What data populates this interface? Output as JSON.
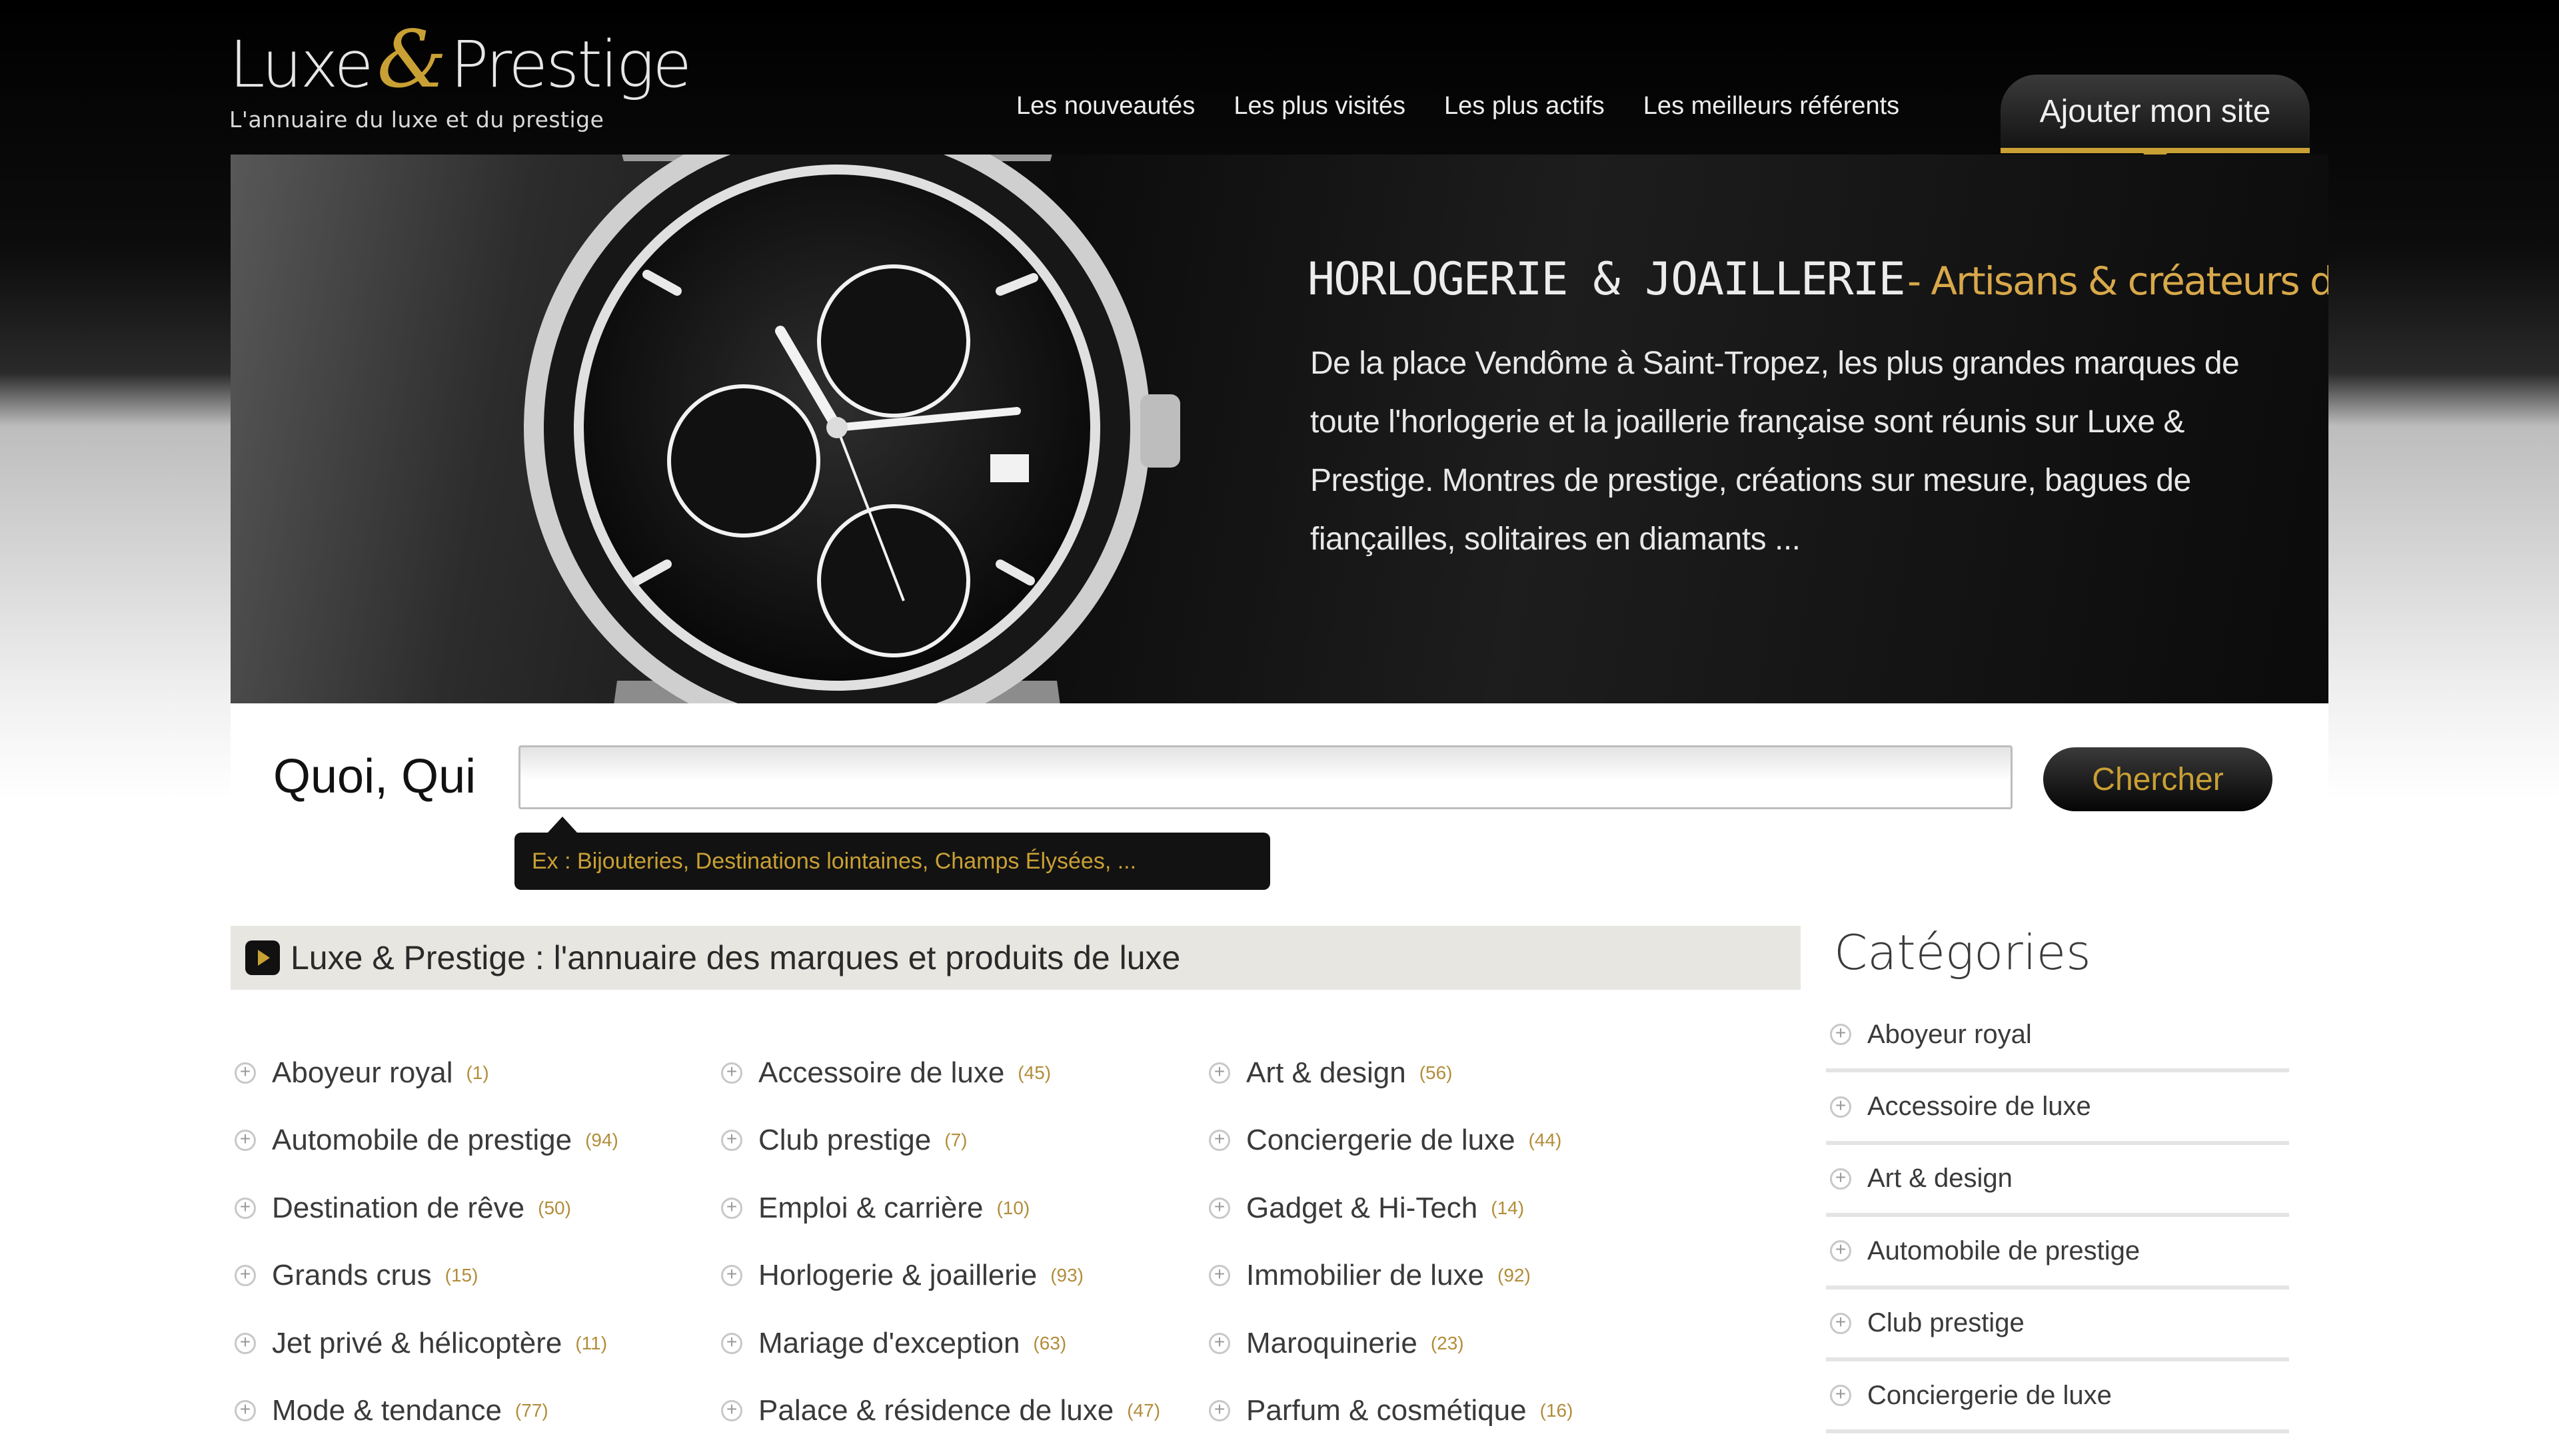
{
  "header": {
    "logo_main_left": "Luxe",
    "logo_amp": "&",
    "logo_main_right": "Prestige",
    "logo_tagline": "L'annuaire du luxe et du prestige",
    "nav": [
      "Les nouveautés",
      "Les plus visités",
      "Les plus actifs",
      "Les meilleurs référents"
    ],
    "add_site": "Ajouter mon site"
  },
  "banner": {
    "title": "HORLOGERIE & JOAILLERIE",
    "subtitle": "- Artisans & créateurs de rêves",
    "text": "De la place Vendôme à Saint-Tropez, les plus grandes marques de toute l'horlogerie et la joaillerie française sont réunis sur Luxe & Prestige.  Montres de prestige, créations sur mesure, bagues de fiançailles, solitaires en diamants ..."
  },
  "search": {
    "label": "Quoi, Qui",
    "value": "",
    "placeholder": "",
    "button": "Chercher",
    "hint": "Ex : Bijouteries, Destinations lointaines, Champs Élysées, ..."
  },
  "directory": {
    "title": "Luxe & Prestige : l'annuaire des marques et produits de luxe",
    "columns": [
      [
        {
          "name": "Aboyeur royal",
          "count": "(1)"
        },
        {
          "name": "Automobile de prestige",
          "count": "(94)"
        },
        {
          "name": "Destination de rêve",
          "count": "(50)"
        },
        {
          "name": "Grands crus",
          "count": "(15)"
        },
        {
          "name": "Jet privé & hélicoptère",
          "count": "(11)"
        },
        {
          "name": "Mode & tendance",
          "count": "(77)"
        }
      ],
      [
        {
          "name": "Accessoire de luxe",
          "count": "(45)"
        },
        {
          "name": "Club prestige",
          "count": "(7)"
        },
        {
          "name": "Emploi & carrière",
          "count": "(10)"
        },
        {
          "name": "Horlogerie & joaillerie",
          "count": "(93)"
        },
        {
          "name": "Mariage d'exception",
          "count": "(63)"
        },
        {
          "name": "Palace & résidence de luxe",
          "count": "(47)"
        }
      ],
      [
        {
          "name": "Art & design",
          "count": "(56)"
        },
        {
          "name": "Conciergerie de luxe",
          "count": "(44)"
        },
        {
          "name": "Gadget & Hi-Tech",
          "count": "(14)"
        },
        {
          "name": "Immobilier de luxe",
          "count": "(92)"
        },
        {
          "name": "Maroquinerie",
          "count": "(23)"
        },
        {
          "name": "Parfum & cosmétique",
          "count": "(16)"
        }
      ]
    ]
  },
  "sidebar": {
    "title": "Catégories",
    "items": [
      "Aboyeur royal",
      "Accessoire de luxe",
      "Art & design",
      "Automobile de prestige",
      "Club prestige",
      "Conciergerie de luxe"
    ]
  },
  "colors": {
    "gold": "#c9a034",
    "dark": "#0b0b0b",
    "section_bar": "#e8e6e1"
  },
  "icons": {
    "section": "play-icon",
    "category_bullet": "plus-circle-icon"
  }
}
